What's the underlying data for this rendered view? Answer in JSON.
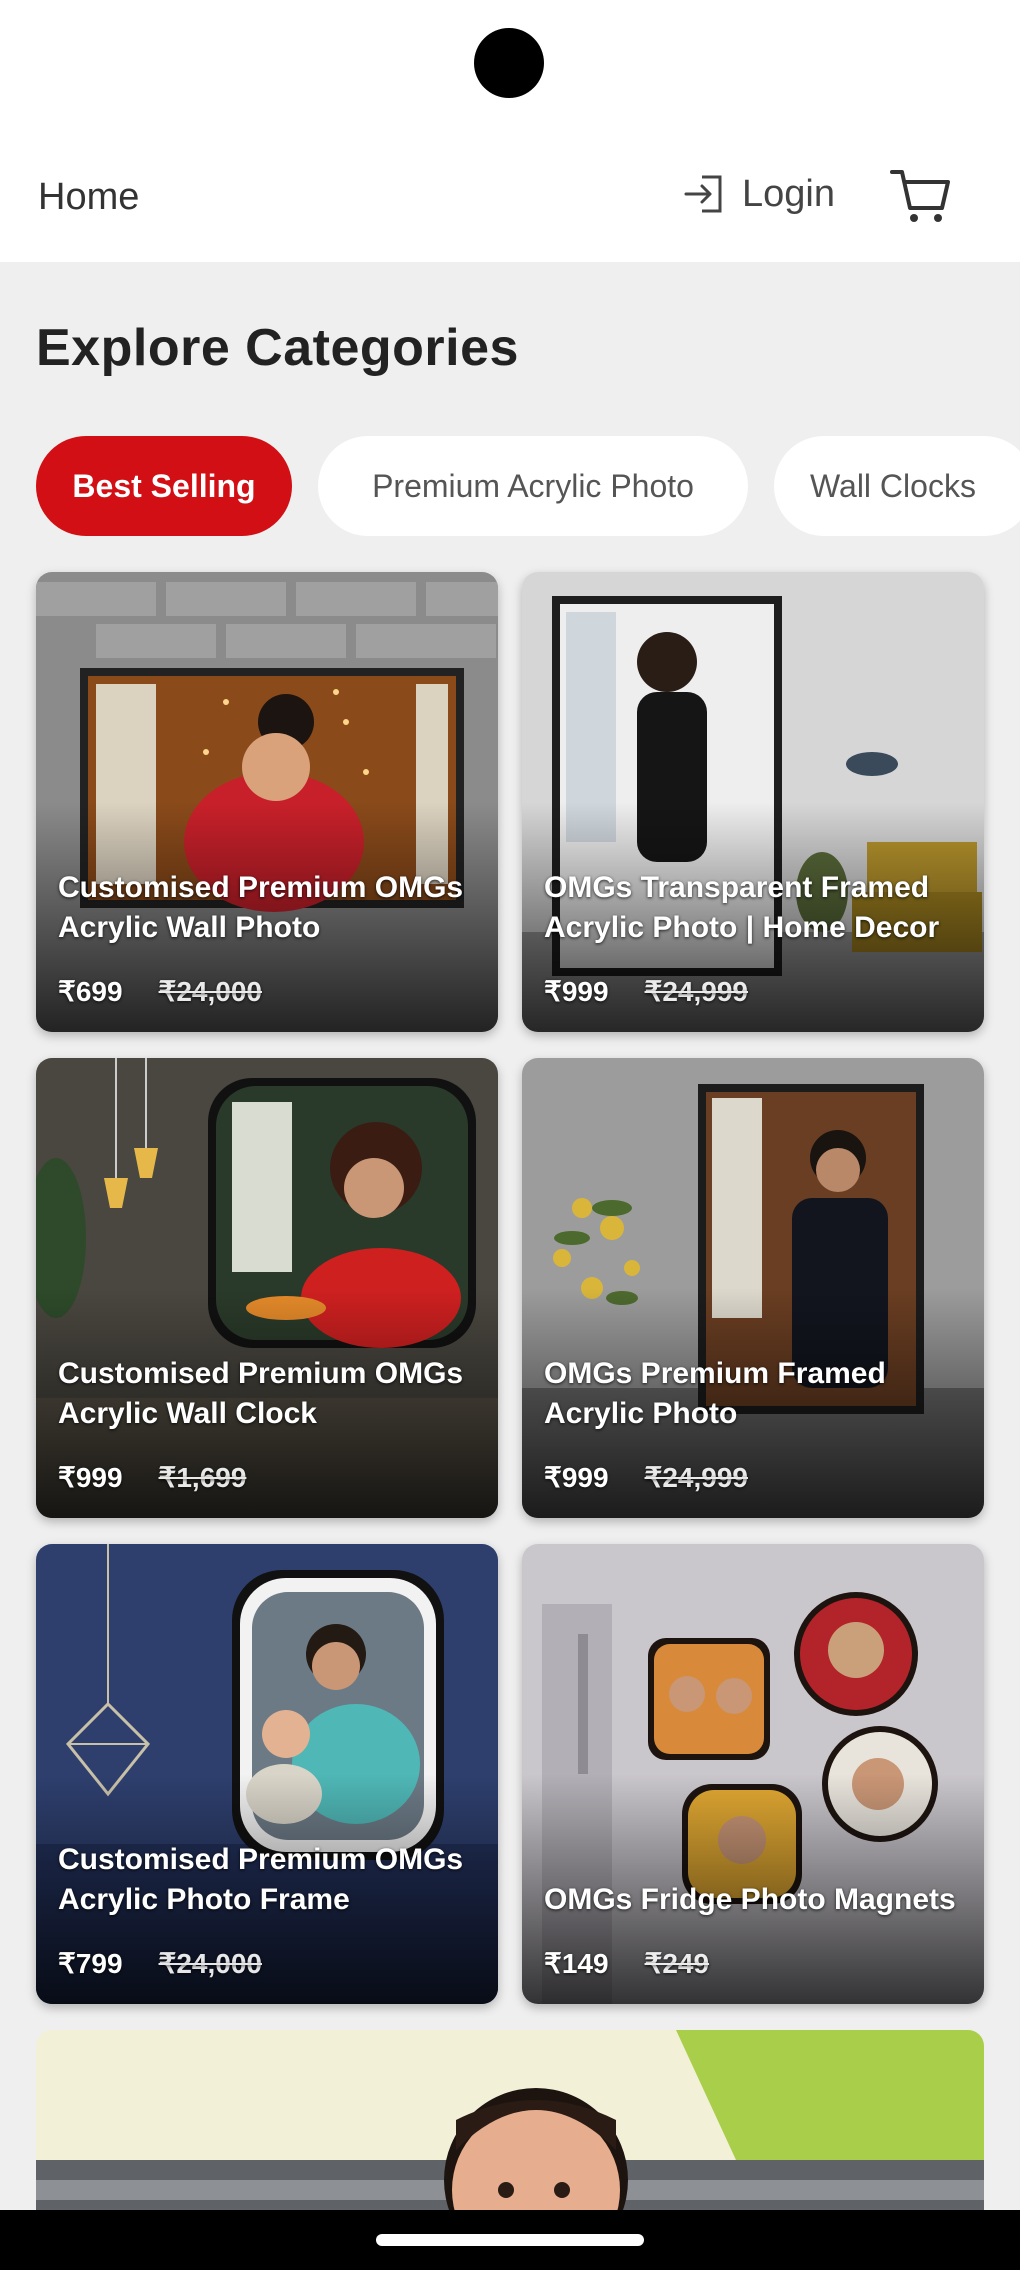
{
  "header": {
    "home_label": "Home",
    "login_label": "Login",
    "login_icon": "login-icon",
    "cart_icon": "cart-icon"
  },
  "section_title": "Explore Categories",
  "chips": [
    {
      "label": "Best Selling",
      "active": true
    },
    {
      "label": "Premium Acrylic Photo",
      "active": false
    },
    {
      "label": "Wall Clocks",
      "active": false
    }
  ],
  "products": [
    {
      "title": "Customised Premium OMGs Acrylic Wall Photo",
      "price": "₹699",
      "mrp": "₹24,000"
    },
    {
      "title": "OMGs Transparent Framed Acrylic Photo | Home Decor",
      "price": "₹999",
      "mrp": "₹24,999"
    },
    {
      "title": "Customised Premium OMGs Acrylic Wall Clock",
      "price": "₹999",
      "mrp": "₹1,699"
    },
    {
      "title": "OMGs Premium Framed Acrylic Photo",
      "price": "₹999",
      "mrp": "₹24,999"
    },
    {
      "title": "Customised Premium OMGs Acrylic Photo Frame",
      "price": "₹799",
      "mrp": "₹24,000"
    },
    {
      "title": "OMGs Fridge Photo Magnets",
      "price": "₹149",
      "mrp": "₹249"
    }
  ],
  "colors": {
    "accent": "#d10f14",
    "background": "#efefef"
  }
}
